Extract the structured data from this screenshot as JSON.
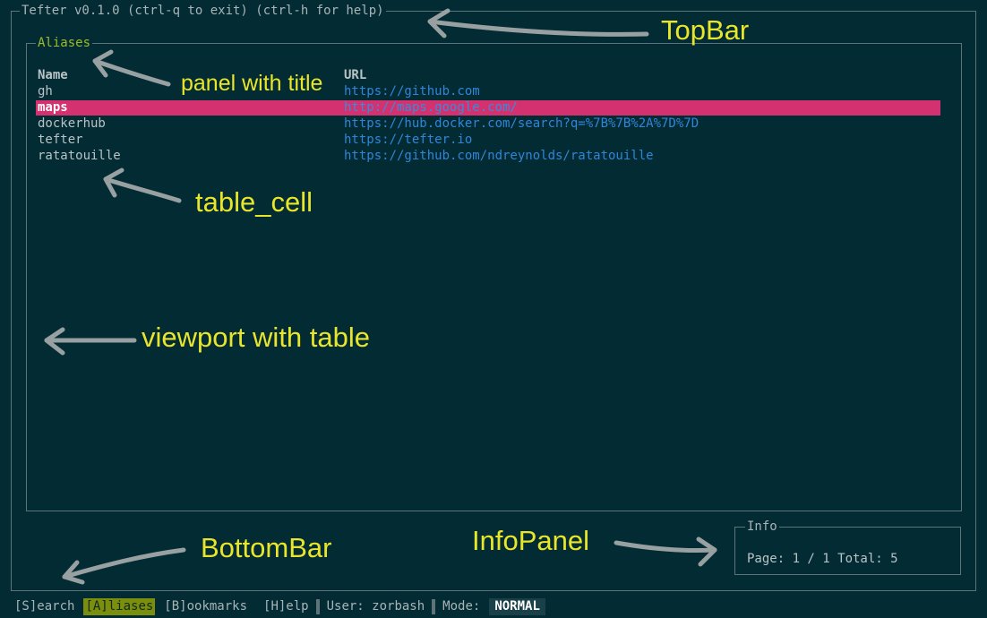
{
  "topbar": {
    "title": "Tefter v0.1.0 (ctrl-q to exit) (ctrl-h for help)"
  },
  "panel": {
    "title": "Aliases"
  },
  "table": {
    "headers": {
      "name": "Name",
      "url": "URL"
    },
    "rows": [
      {
        "name": "gh",
        "url": "https://github.com"
      },
      {
        "name": "maps",
        "url": "http://maps.google.com/"
      },
      {
        "name": "dockerhub",
        "url": "https://hub.docker.com/search?q=%7B%7B%2A%7D%7D"
      },
      {
        "name": "tefter",
        "url": "https://tefter.io"
      },
      {
        "name": "ratatouille",
        "url": "https://github.com/ndreynolds/ratatouille"
      }
    ],
    "selected_row": 1
  },
  "info": {
    "title": "Info",
    "text": "Page: 1 / 1 Total: 5"
  },
  "bottombar": {
    "search": "[S]earch",
    "aliases": "[A]liases",
    "bookmarks": "[B]ookmarks",
    "help": "[H]elp",
    "user": "User: zorbash",
    "mode_label": "Mode:",
    "mode_value": "NORMAL"
  },
  "annotations": {
    "topbar": "TopBar",
    "panel": "panel with title",
    "table_cell": "table_cell",
    "viewport": "viewport with table",
    "bottombar": "BottomBar",
    "infopanel": "InfoPanel"
  },
  "colors": {
    "background": "#022b33",
    "annotation": "#e9e52b",
    "selected_row": "#d3316f",
    "url": "#2f86d9",
    "active_tab": "#7c8f0d",
    "panel_title": "#9bbd2a"
  }
}
